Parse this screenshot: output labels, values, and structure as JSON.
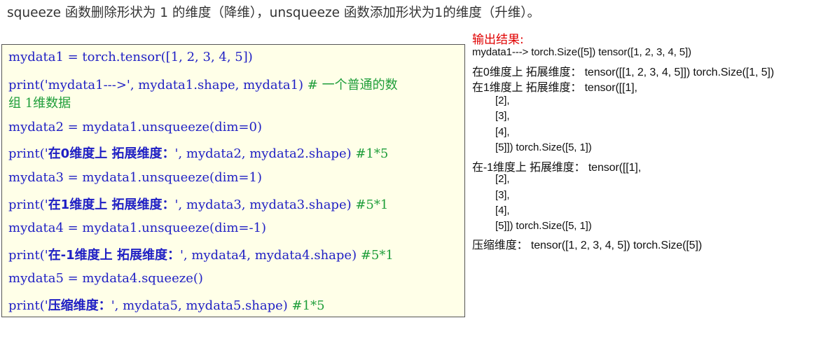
{
  "intro": "squeeze 函数删除形状为 1 的维度（降维），unsqueeze 函数添加形状为1的维度（升维）。",
  "code": {
    "l1": "mydata1 = torch.tensor([1, 2, 3, 4, 5])",
    "l2_a": "print('mydata1--->', mydata1.shape, mydata1) ",
    "l2_comment": "# 一个普通的数",
    "l2_comment_cont": "组 1维数据",
    "l3": "mydata2 = mydata1.unsqueeze(dim=0)",
    "l4_a": "print('",
    "l4_cn": "在0维度上 拓展维度：",
    "l4_b": "', mydata2, mydata2.shape)  ",
    "l4_comment": "#1*5",
    "l5": "mydata3 = mydata1.unsqueeze(dim=1)",
    "l6_a": "print('",
    "l6_cn": "在1维度上 拓展维度：",
    "l6_b": "', mydata3, mydata3.shape)  ",
    "l6_comment": "#5*1",
    "l7": "mydata4 = mydata1.unsqueeze(dim=-1)",
    "l8_a": "print('",
    "l8_cn": "在-1维度上 拓展维度：",
    "l8_b": "', mydata4, mydata4.shape) ",
    "l8_comment": "#5*1",
    "l9": "mydata5 = mydata4.squeeze()",
    "l10_a": "print('",
    "l10_cn": "压缩维度：",
    "l10_b": "', mydata5, mydata5.shape)  ",
    "l10_comment": "#1*5"
  },
  "output": {
    "title": "输出结果:",
    "lines": [
      "mydata1---> torch.Size([5]) tensor([1, 2, 3, 4, 5])",
      "在0维度上 拓展维度：  tensor([[1, 2, 3, 4, 5]]) torch.Size([1, 5])",
      "在1维度上 拓展维度：  tensor([[1],",
      "[2],",
      "[3],",
      "[4],",
      "[5]]) torch.Size([5, 1])",
      "在-1维度上 拓展维度：  tensor([[1],",
      "[2],",
      "[3],",
      "[4],",
      "[5]]) torch.Size([5, 1])",
      "压缩维度：  tensor([1, 2, 3, 4, 5]) torch.Size([5])"
    ]
  }
}
